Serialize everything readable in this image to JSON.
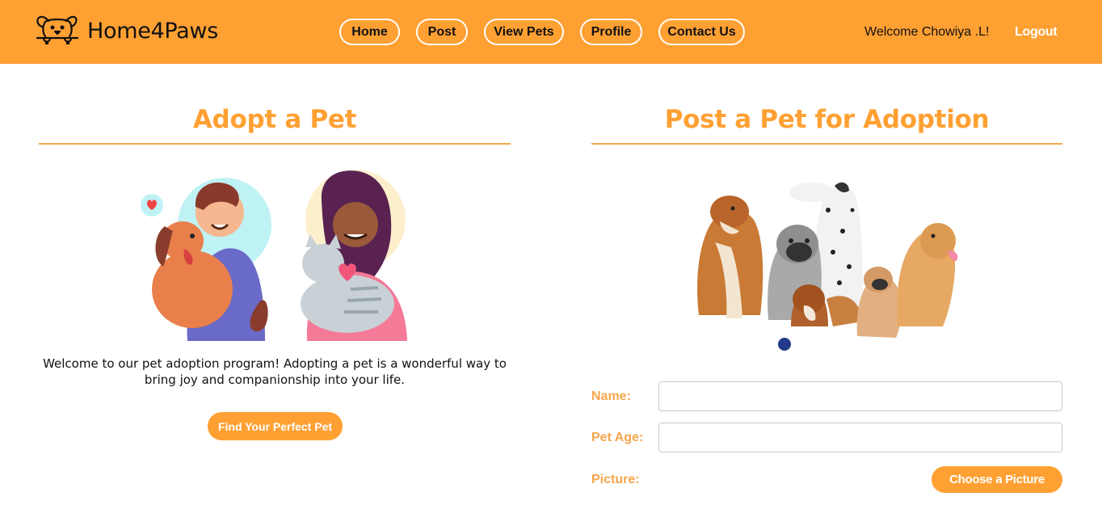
{
  "header": {
    "brand": "Home4Paws",
    "logo_icon": "dog-face-icon",
    "nav": [
      {
        "label": "Home"
      },
      {
        "label": "Post"
      },
      {
        "label": "View Pets"
      },
      {
        "label": "Profile"
      },
      {
        "label": "Contact Us"
      }
    ],
    "welcome": "Welcome Chowiya .L!",
    "logout_label": "Logout"
  },
  "adopt": {
    "title": "Adopt a Pet",
    "illustration_icon": "people-hugging-pets-illustration",
    "intro": "Welcome to our pet adoption program! Adopting a pet is a wonderful way to bring joy and companionship into your life.",
    "cta_label": "Find Your Perfect Pet"
  },
  "post": {
    "title": "Post a Pet for Adoption",
    "illustration_icon": "group-of-dogs-illustration",
    "fields": [
      {
        "label": "Name:",
        "value": ""
      },
      {
        "label": "Pet Age:",
        "value": ""
      }
    ],
    "picture_label": "Picture:",
    "choose_label": "Choose a Picture"
  },
  "colors": {
    "accent": "#ffa033",
    "label": "#f7a54a"
  }
}
